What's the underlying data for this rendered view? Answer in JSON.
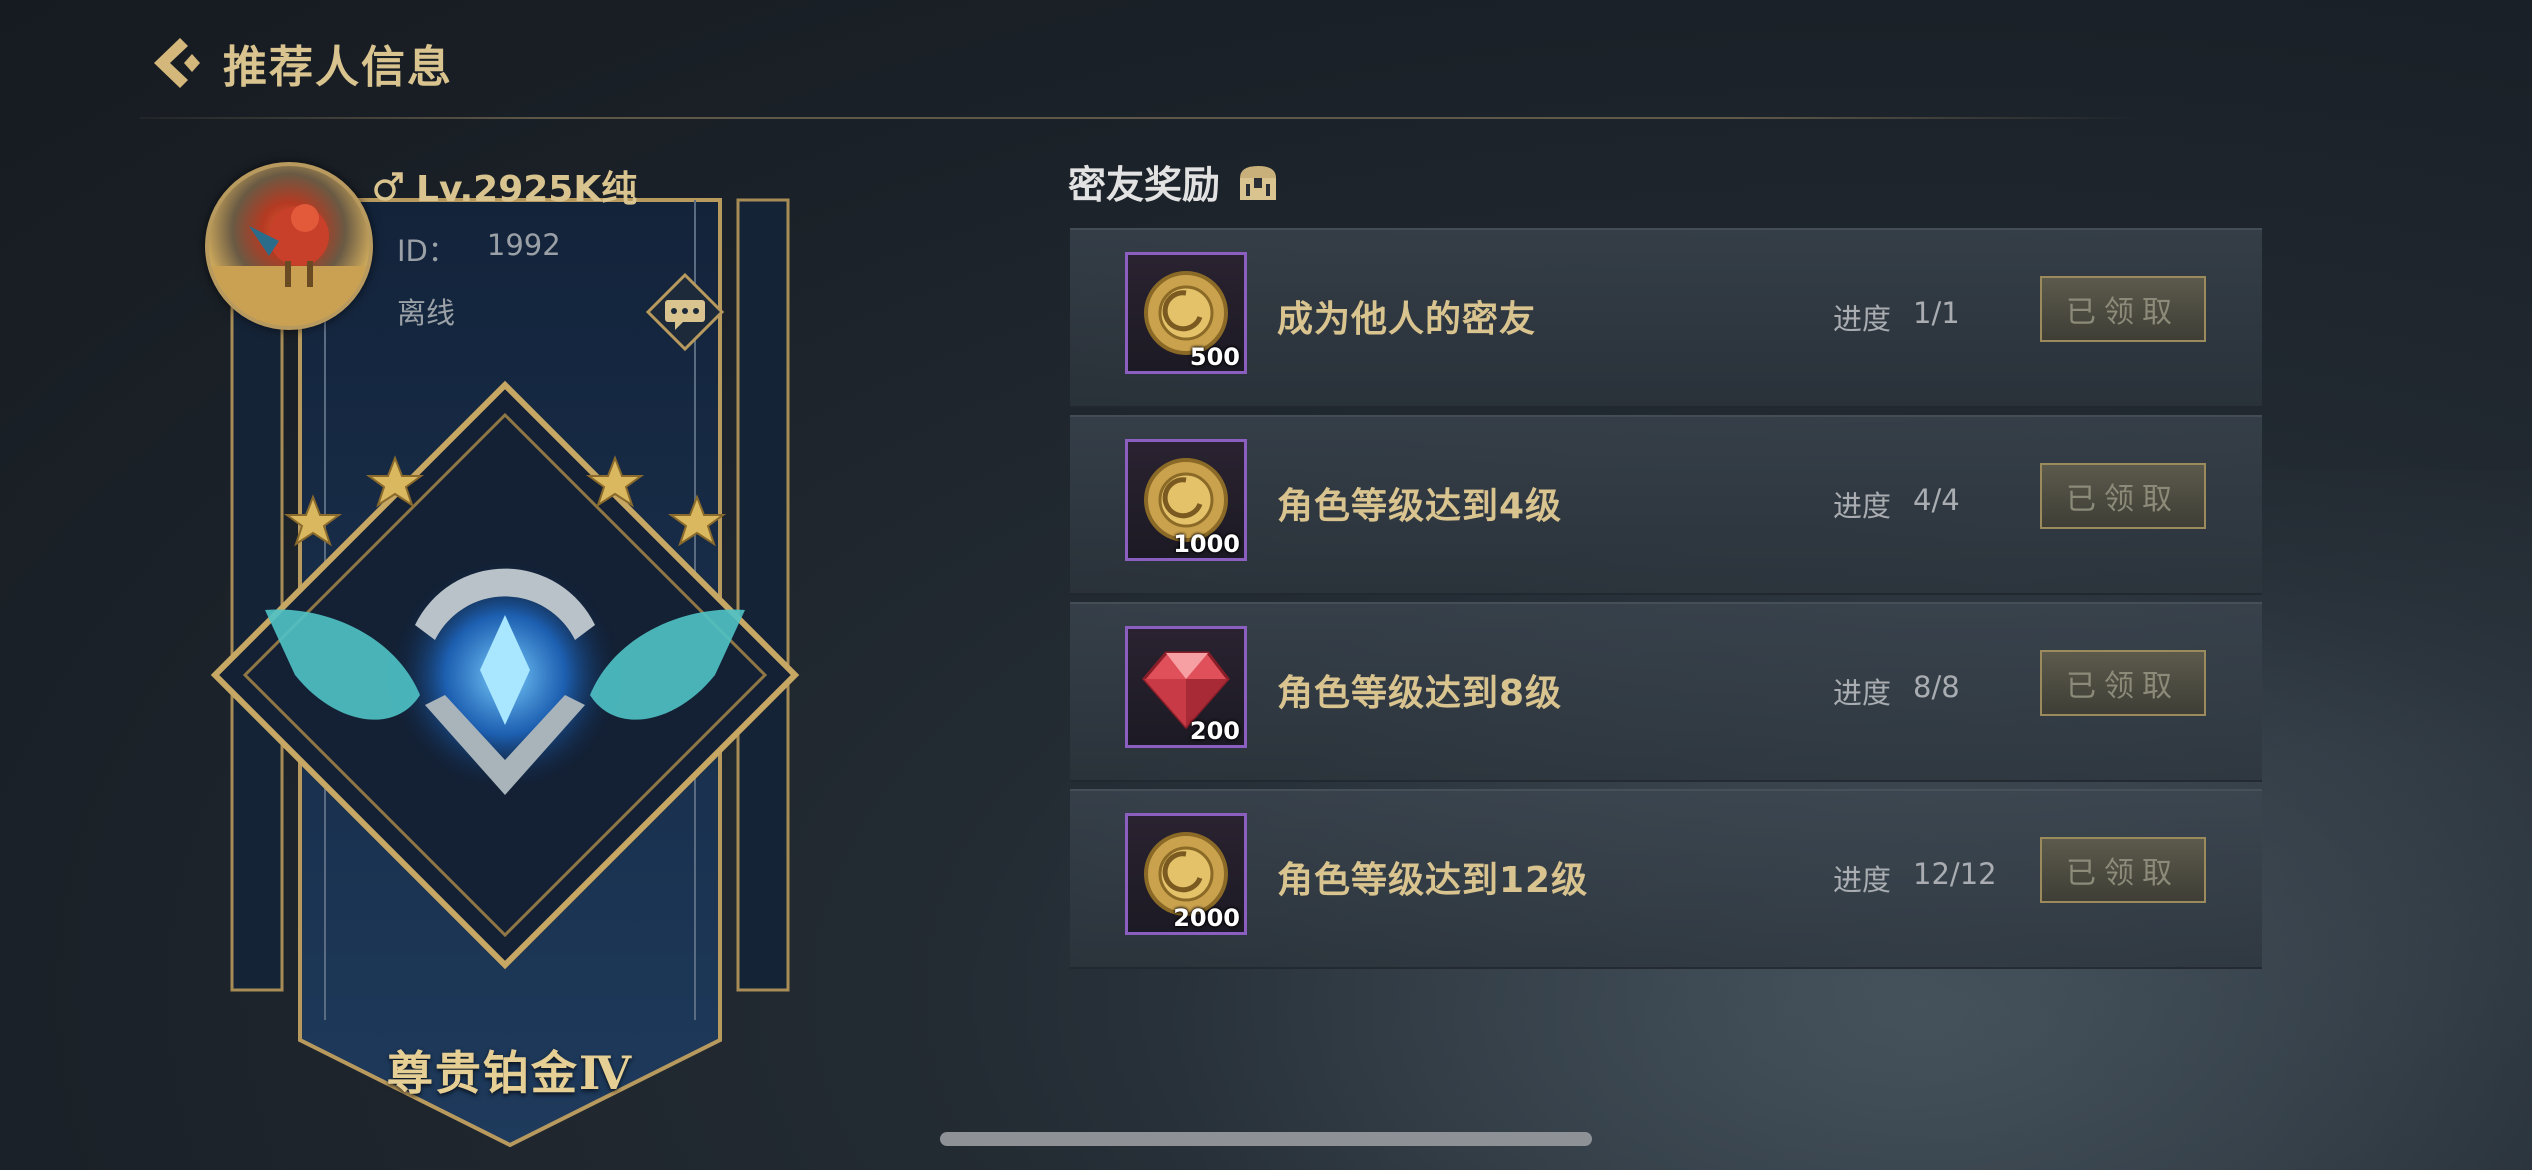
{
  "header": {
    "title": "推荐人信息",
    "back_icon": "chevron-left-icon"
  },
  "profile": {
    "gender_icon": "male-icon",
    "level": "Lv.2925K纯",
    "id_label": "ID：",
    "id_value": "1992",
    "status": "离线",
    "chat_icon": "chat-bubble-icon",
    "rank_name": "尊贵铂金Ⅳ",
    "rank_stars": 4
  },
  "rewards": {
    "section_title": "密友奖励",
    "section_icon": "treasure-chest-icon",
    "items": [
      {
        "icon": "gold-coin-icon",
        "count": "500",
        "desc": "成为他人的密友",
        "progress_label": "进度",
        "progress": "1/1",
        "button": "已领取"
      },
      {
        "icon": "gold-coin-icon",
        "count": "1000",
        "desc": "角色等级达到4级",
        "progress_label": "进度",
        "progress": "4/4",
        "button": "已领取"
      },
      {
        "icon": "red-gem-icon",
        "count": "200",
        "desc": "角色等级达到8级",
        "progress_label": "进度",
        "progress": "8/8",
        "button": "已领取"
      },
      {
        "icon": "gold-coin-icon",
        "count": "2000",
        "desc": "角色等级达到12级",
        "progress_label": "进度",
        "progress": "12/12",
        "button": "已领取"
      }
    ]
  },
  "colors": {
    "accent_gold": "#d9c48f",
    "item_border_purple": "#8a5fc0",
    "background": "#1b2128"
  }
}
